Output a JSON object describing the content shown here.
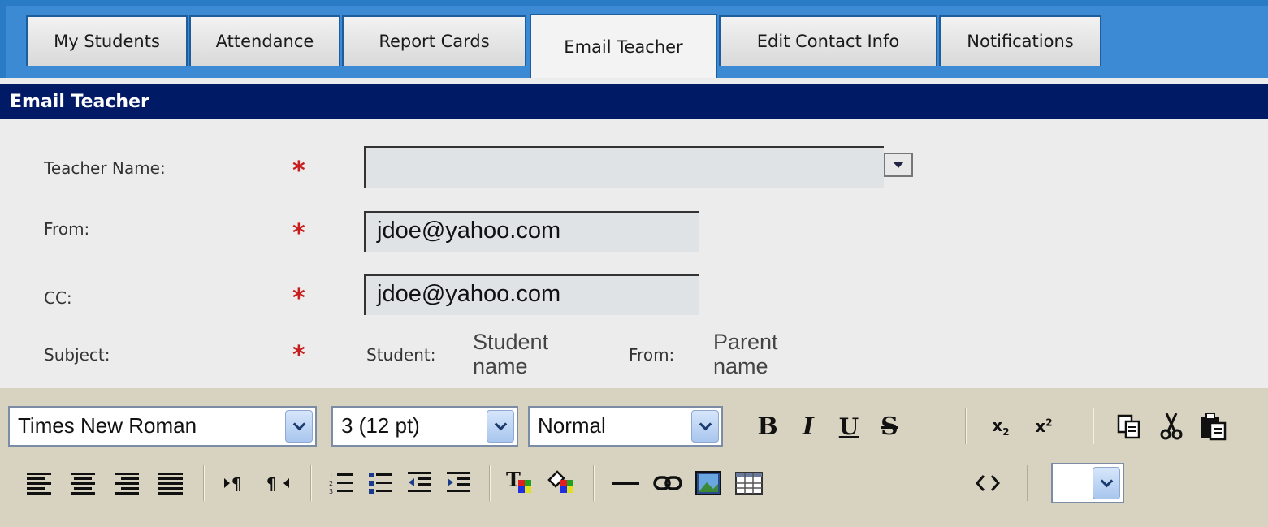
{
  "tabs": [
    {
      "label": "My Students",
      "active": false
    },
    {
      "label": "Attendance",
      "active": false
    },
    {
      "label": "Report Cards",
      "active": false
    },
    {
      "label": "Email Teacher",
      "active": true
    },
    {
      "label": "Edit Contact Info",
      "active": false
    },
    {
      "label": "Notifications",
      "active": false
    }
  ],
  "section": {
    "title": "Email Teacher"
  },
  "form": {
    "teacher_label": "Teacher Name:",
    "from_label": "From:",
    "cc_label": "CC:",
    "subject_label": "Subject:",
    "required_mark": "*",
    "teacher_value": "",
    "from_value": "jdoe@yahoo.com",
    "cc_value": "jdoe@yahoo.com",
    "subject": {
      "student_label": "Student:",
      "student_value": "Student name",
      "from_label": "From:",
      "from_value": "Parent name"
    }
  },
  "editor": {
    "font_family": "Times New Roman",
    "font_size": "3 (12 pt)",
    "paragraph_style": "Normal",
    "buttons": {
      "bold": "B",
      "italic": "I",
      "underline": "U",
      "strike": "S"
    },
    "color_value": ""
  },
  "colors": {
    "tab_bar": "#2a7bc6",
    "section_header": "#001a66",
    "required": "#c81d1d",
    "toolbar": "#d8d2c0"
  }
}
